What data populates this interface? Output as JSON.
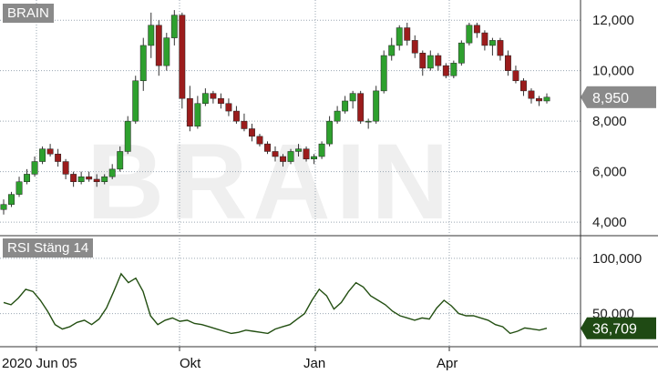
{
  "chart_data": [
    {
      "type": "candlestick",
      "title": "BRAIN",
      "watermark": "BRAIN",
      "ylim": [
        3500,
        12800
      ],
      "yticks": [
        4000,
        6000,
        8000,
        10000,
        12000
      ],
      "ytick_labels": [
        "4,000",
        "6,000",
        "8,000",
        "10,000",
        "12,000"
      ],
      "last_value_label": "8,950",
      "last_value": 8950,
      "up_color": "#2ea02e",
      "down_color": "#9b1c1c",
      "series": [
        {
          "values": [
            [
              4500,
              4900,
              4300,
              4700
            ],
            [
              4700,
              5200,
              4600,
              5100
            ],
            [
              5100,
              5800,
              5000,
              5600
            ],
            [
              5600,
              6100,
              5500,
              5900
            ],
            [
              5900,
              6600,
              5800,
              6400
            ],
            [
              6400,
              7000,
              6300,
              6900
            ],
            [
              6900,
              7100,
              6600,
              6700
            ],
            [
              6700,
              6900,
              6200,
              6400
            ],
            [
              6400,
              6500,
              5700,
              5900
            ],
            [
              5900,
              6000,
              5400,
              5600
            ],
            [
              5600,
              6000,
              5500,
              5800
            ],
            [
              5800,
              6000,
              5600,
              5700
            ],
            [
              5700,
              5900,
              5400,
              5600
            ],
            [
              5600,
              5900,
              5500,
              5800
            ],
            [
              5800,
              6300,
              5700,
              6100
            ],
            [
              6100,
              7000,
              6000,
              6800
            ],
            [
              6800,
              8200,
              6700,
              8000
            ],
            [
              8000,
              9800,
              7900,
              9600
            ],
            [
              9600,
              11300,
              9200,
              11000
            ],
            [
              11000,
              12300,
              10500,
              11800
            ],
            [
              11800,
              12000,
              9800,
              10200
            ],
            [
              10200,
              11500,
              10000,
              11300
            ],
            [
              11300,
              12400,
              11000,
              12200
            ],
            [
              12200,
              12300,
              8500,
              8900
            ],
            [
              8900,
              9400,
              7600,
              7800
            ],
            [
              7800,
              9000,
              7700,
              8700
            ],
            [
              8700,
              9300,
              8600,
              9100
            ],
            [
              9100,
              9200,
              8700,
              8900
            ],
            [
              8900,
              9100,
              8500,
              8700
            ],
            [
              8700,
              8900,
              8200,
              8400
            ],
            [
              8400,
              8600,
              7900,
              8000
            ],
            [
              8000,
              8300,
              7600,
              7700
            ],
            [
              7700,
              7900,
              7200,
              7400
            ],
            [
              7400,
              7500,
              7000,
              7100
            ],
            [
              7100,
              7200,
              6700,
              6800
            ],
            [
              6800,
              7000,
              6400,
              6600
            ],
            [
              6600,
              6700,
              6200,
              6400
            ],
            [
              6400,
              6900,
              6300,
              6800
            ],
            [
              6800,
              7100,
              6600,
              6900
            ],
            [
              6900,
              7000,
              6400,
              6500
            ],
            [
              6500,
              6700,
              6300,
              6600
            ],
            [
              6600,
              7200,
              6500,
              7100
            ],
            [
              7100,
              8200,
              7000,
              8000
            ],
            [
              8000,
              8600,
              7900,
              8400
            ],
            [
              8400,
              9000,
              8300,
              8800
            ],
            [
              8800,
              9200,
              8500,
              9100
            ],
            [
              9100,
              9200,
              7900,
              8000
            ],
            [
              8000,
              8100,
              7700,
              8000
            ],
            [
              8000,
              9400,
              7900,
              9200
            ],
            [
              9200,
              10800,
              9100,
              10600
            ],
            [
              10600,
              11300,
              10400,
              11000
            ],
            [
              11000,
              11800,
              10800,
              11700
            ],
            [
              11700,
              11900,
              11000,
              11200
            ],
            [
              11200,
              11400,
              10500,
              10700
            ],
            [
              10700,
              10800,
              9800,
              10100
            ],
            [
              10100,
              10800,
              10000,
              10600
            ],
            [
              10600,
              10700,
              10000,
              10200
            ],
            [
              10200,
              10300,
              9700,
              9800
            ],
            [
              9800,
              10400,
              9700,
              10300
            ],
            [
              10300,
              11200,
              10200,
              11100
            ],
            [
              11100,
              11900,
              11000,
              11800
            ],
            [
              11800,
              11900,
              11300,
              11500
            ],
            [
              11500,
              11600,
              10800,
              11000
            ],
            [
              11000,
              11300,
              10600,
              11200
            ],
            [
              11200,
              11300,
              10400,
              10600
            ],
            [
              10600,
              10800,
              9800,
              10000
            ],
            [
              10000,
              10200,
              9500,
              9600
            ],
            [
              9600,
              9700,
              9000,
              9200
            ],
            [
              9200,
              9300,
              8700,
              8900
            ],
            [
              8900,
              9000,
              8600,
              8800
            ],
            [
              8800,
              9100,
              8700,
              8950
            ]
          ]
        }
      ]
    },
    {
      "type": "line",
      "title": "RSI Stäng 14",
      "ylim": [
        20,
        118
      ],
      "yticks": [
        50,
        100
      ],
      "ytick_labels": [
        "50,000",
        "100,000"
      ],
      "last_value_label": "36,709",
      "last_value": 36.709,
      "line_color": "#234f12",
      "x": [
        "2020 Jun 05",
        "Okt",
        "Jan",
        "Apr"
      ],
      "series": [
        {
          "values": [
            60,
            58,
            64,
            72,
            70,
            62,
            52,
            40,
            36,
            38,
            42,
            44,
            40,
            45,
            55,
            70,
            86,
            78,
            82,
            70,
            48,
            40,
            44,
            46,
            43,
            44,
            41,
            40,
            38,
            36,
            34,
            32,
            33,
            35,
            34,
            33,
            32,
            36,
            38,
            40,
            45,
            50,
            62,
            72,
            66,
            54,
            60,
            70,
            78,
            74,
            66,
            62,
            58,
            52,
            48,
            46,
            44,
            46,
            45,
            55,
            62,
            57,
            50,
            48,
            48,
            46,
            44,
            40,
            38,
            32,
            34,
            37,
            36,
            35,
            36.709
          ]
        }
      ]
    }
  ],
  "x_axis": {
    "ticks": [
      "2020 Jun 05",
      "Okt",
      "Jan",
      "Apr"
    ]
  }
}
